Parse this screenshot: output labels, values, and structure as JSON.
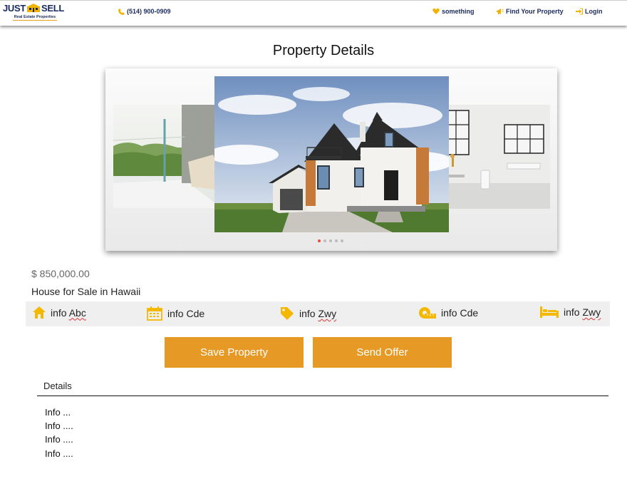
{
  "header": {
    "logo_left": "JUST",
    "logo_right": "SELL",
    "logo_sub": "Real Estate Properties",
    "phone": "(514) 900-0909",
    "nav": [
      {
        "label": "something",
        "icon": "heart-icon"
      },
      {
        "label": "Find Your Property",
        "icon": "megaphone-icon"
      },
      {
        "label": "Login",
        "icon": "login-icon"
      }
    ]
  },
  "page_title": "Property Details",
  "carousel": {
    "slides": [
      "balcony-photo",
      "house-photo",
      "bathroom-photo"
    ],
    "dot_count": 5,
    "active_dot": 1
  },
  "property": {
    "price": "$ 850,000.00",
    "title": "House for Sale in Hawaii"
  },
  "info_items": [
    {
      "prefix": "info ",
      "word": "Abc",
      "icon": "home-icon"
    },
    {
      "prefix": "info ",
      "word": "Cde",
      "icon": "calendar-icon"
    },
    {
      "prefix": "info ",
      "word": "Zwy",
      "icon": "price-tag-icon"
    },
    {
      "prefix": "info ",
      "word": "Cde",
      "icon": "tape-measure-icon"
    },
    {
      "prefix": "info ",
      "word": "Zwy",
      "icon": "bed-icon"
    }
  ],
  "actions": {
    "save_label": "Save Property",
    "offer_label": "Send Offer"
  },
  "details": {
    "heading": "Details",
    "lines": [
      "Info ...",
      "Info ....",
      "Info ....",
      "Info ...."
    ]
  },
  "colors": {
    "accent": "#e69a25",
    "icon_yellow": "#f5b800",
    "brand_navy": "#1a2a5e",
    "active_dot": "#e74c3c"
  }
}
